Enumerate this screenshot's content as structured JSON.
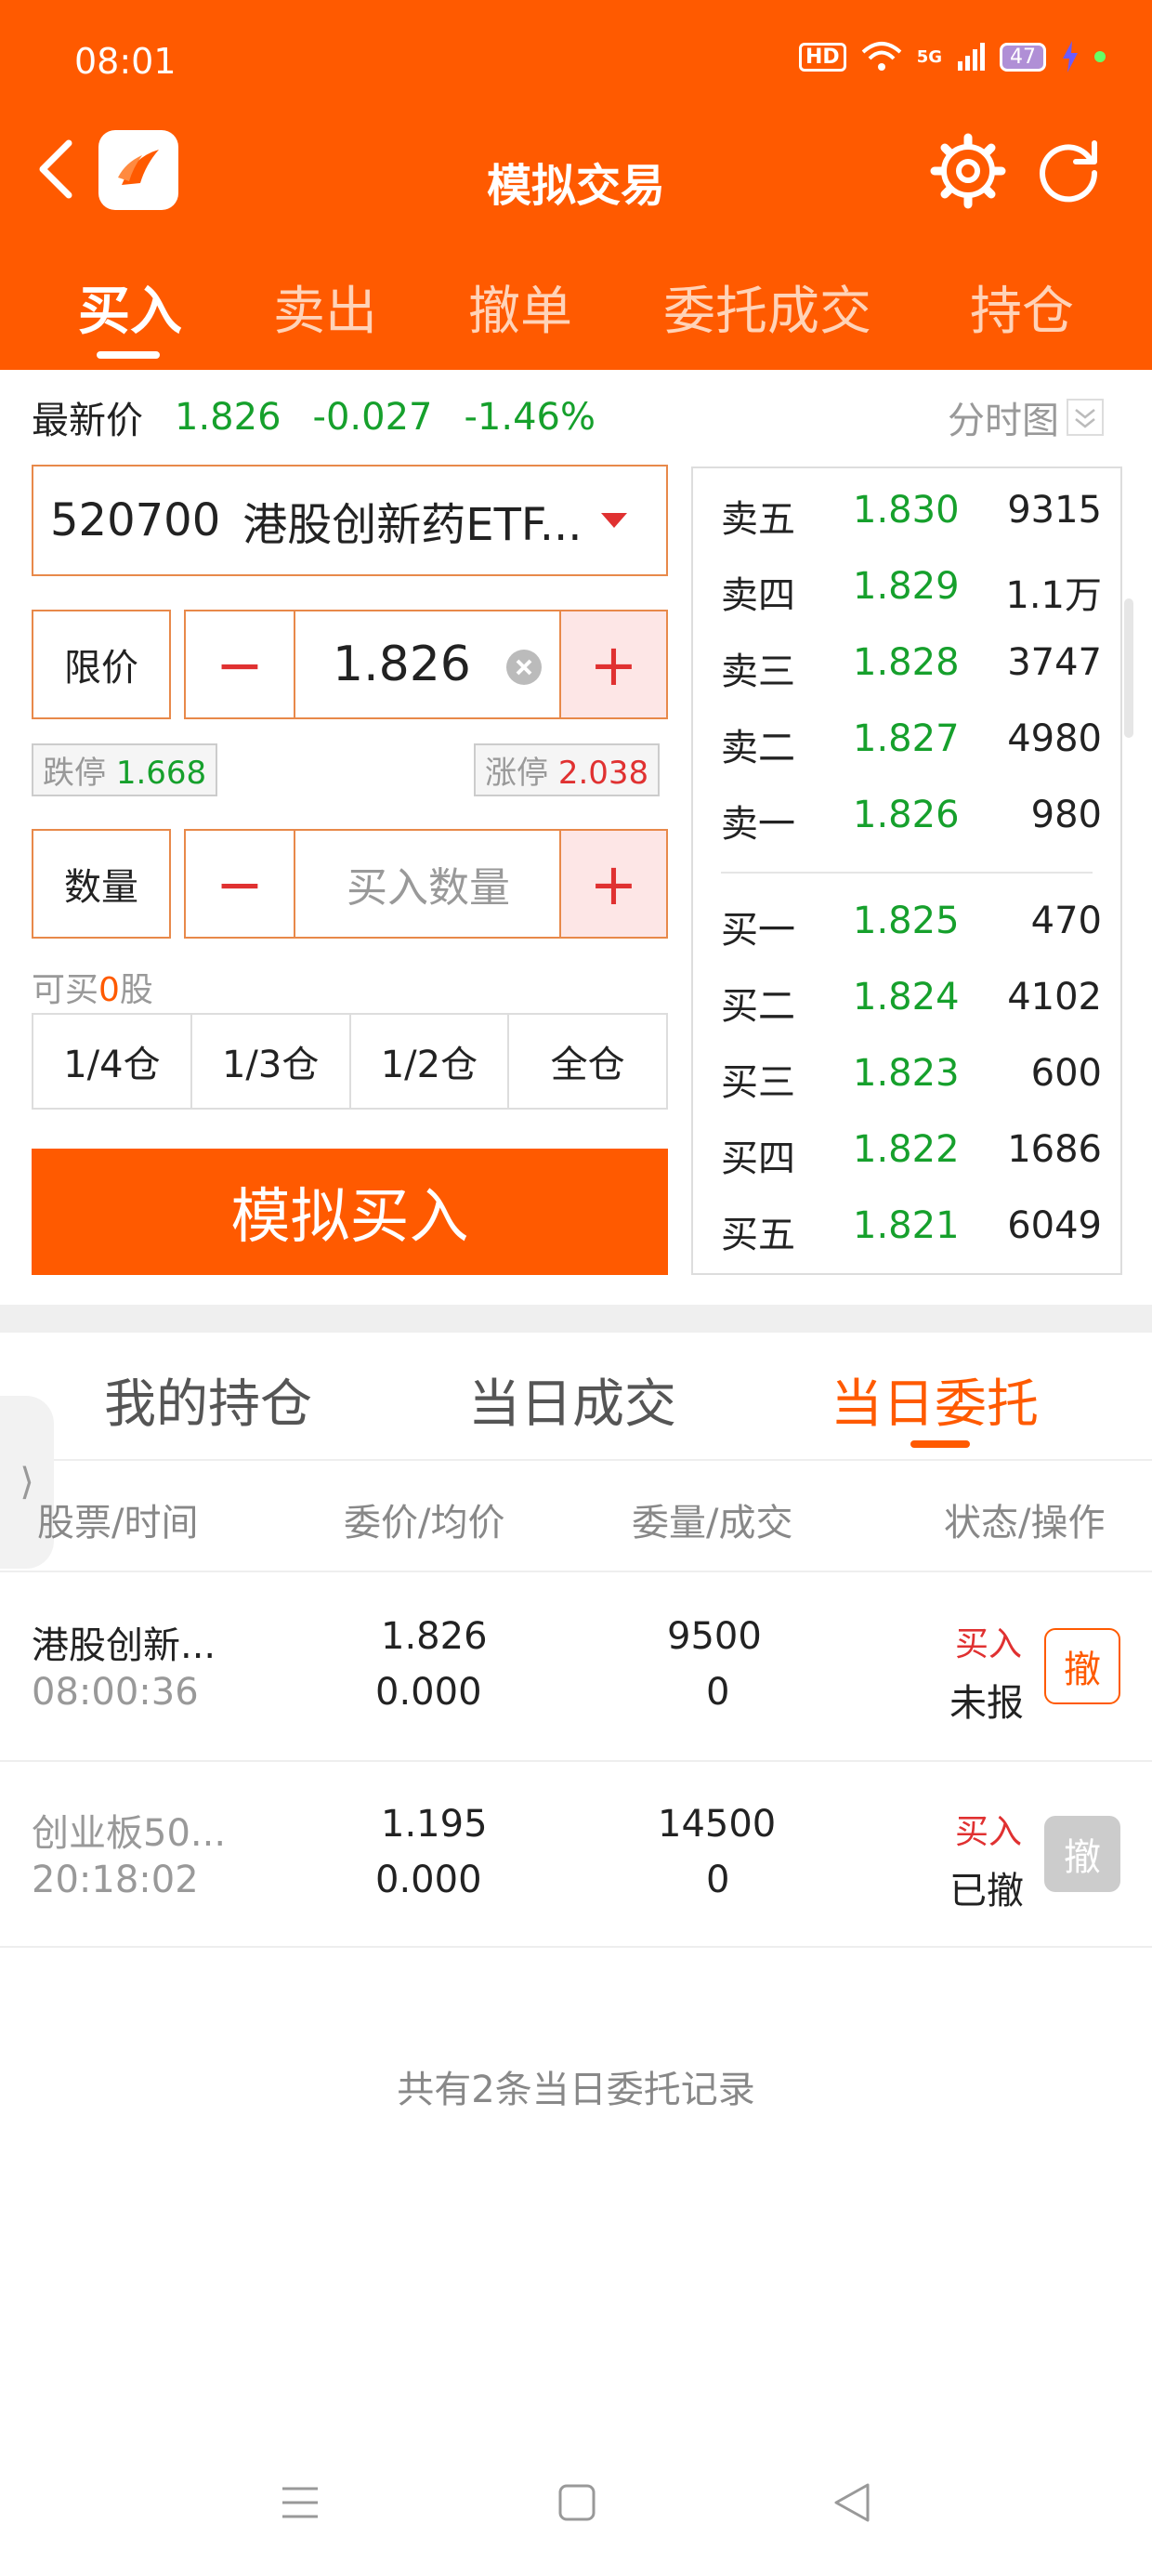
{
  "status": {
    "time": "08:01",
    "hd": "HD",
    "net": "5G",
    "battery": "47"
  },
  "header": {
    "title": "模拟交易",
    "tabs": [
      "买入",
      "卖出",
      "撤单",
      "委托成交",
      "持仓"
    ],
    "active_tab": "买入"
  },
  "quote": {
    "label": "最新价",
    "price": "1.826",
    "change": "-0.027",
    "pct": "-1.46%",
    "chart_link": "分时图"
  },
  "stock": {
    "code": "520700",
    "name": "港股创新药ETF..."
  },
  "price_input": {
    "type": "限价",
    "minus": "−",
    "value": "1.826",
    "plus": "+",
    "limit_down_label": "跌停",
    "limit_down": "1.668",
    "limit_up_label": "涨停",
    "limit_up": "2.038"
  },
  "qty_input": {
    "label": "数量",
    "minus": "−",
    "placeholder": "买入数量",
    "plus": "+",
    "available_pre": "可买",
    "available": "0",
    "available_post": "股"
  },
  "position_buttons": [
    "1/4仓",
    "1/3仓",
    "1/2仓",
    "全仓"
  ],
  "buy_button": "模拟买入",
  "order_book": {
    "asks": [
      {
        "label": "卖五",
        "price": "1.830",
        "vol": "9315"
      },
      {
        "label": "卖四",
        "price": "1.829",
        "vol": "1.1万"
      },
      {
        "label": "卖三",
        "price": "1.828",
        "vol": "3747"
      },
      {
        "label": "卖二",
        "price": "1.827",
        "vol": "4980"
      },
      {
        "label": "卖一",
        "price": "1.826",
        "vol": "980"
      }
    ],
    "bids": [
      {
        "label": "买一",
        "price": "1.825",
        "vol": "470"
      },
      {
        "label": "买二",
        "price": "1.824",
        "vol": "4102"
      },
      {
        "label": "买三",
        "price": "1.823",
        "vol": "600"
      },
      {
        "label": "买四",
        "price": "1.822",
        "vol": "1686"
      },
      {
        "label": "买五",
        "price": "1.821",
        "vol": "6049"
      }
    ]
  },
  "bottom_tabs": [
    "我的持仓",
    "当日成交",
    "当日委托"
  ],
  "table": {
    "headers": [
      "股票/时间",
      "委价/均价",
      "委量/成交",
      "状态/操作"
    ],
    "rows": [
      {
        "name": "港股创新...",
        "time": "08:00:36",
        "price": "1.826",
        "avg": "0.000",
        "qty": "9500",
        "filled": "0",
        "side": "买入",
        "status": "未报",
        "action": "撤"
      },
      {
        "name": "创业板50...",
        "time": "20:18:02",
        "price": "1.195",
        "avg": "0.000",
        "qty": "14500",
        "filled": "0",
        "side": "买入",
        "status": "已撤",
        "action": "撤"
      }
    ]
  },
  "footer": "共有2条当日委托记录",
  "side_handle": "⟩"
}
